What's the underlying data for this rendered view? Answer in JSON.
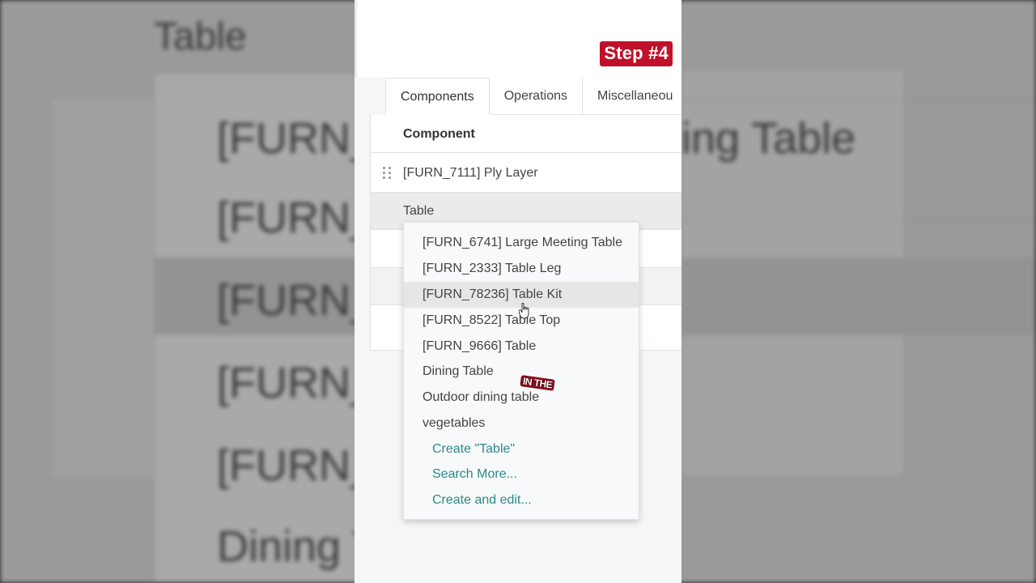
{
  "badge": {
    "step": "Step #4"
  },
  "tabs": [
    {
      "label": "Components",
      "active": true
    },
    {
      "label": "Operations",
      "active": false
    },
    {
      "label": "Miscellaneou",
      "active": false
    }
  ],
  "table": {
    "header": "Component",
    "rows": [
      {
        "label": "[FURN_7111] Ply Layer"
      }
    ],
    "editing_value": "Table"
  },
  "dropdown": {
    "options": [
      "[FURN_6741] Large Meeting Table",
      "[FURN_2333] Table Leg",
      "[FURN_78236] Table Kit",
      "[FURN_8522] Table Top",
      "[FURN_9666] Table",
      "Dining Table",
      "Outdoor dining table",
      "vegetables"
    ],
    "highlighted_index": 2,
    "actions": [
      "Create \"Table\"",
      "Search More...",
      "Create and edit..."
    ]
  },
  "caption": "IN THE",
  "background": {
    "title": "Table",
    "lines_left": [
      "[FURN_",
      "[FURN_",
      "[FURN_",
      "[FURN_",
      "[FURN_",
      "Dining T"
    ],
    "lines_right": [
      "ing Table"
    ]
  },
  "colors": {
    "badge": "#c0102a",
    "action_link": "#2a8a87",
    "highlight_row": "#e5e7e6"
  },
  "icons": {
    "drag": "drag-handle-icon",
    "cursor": "hand-cursor-icon"
  }
}
